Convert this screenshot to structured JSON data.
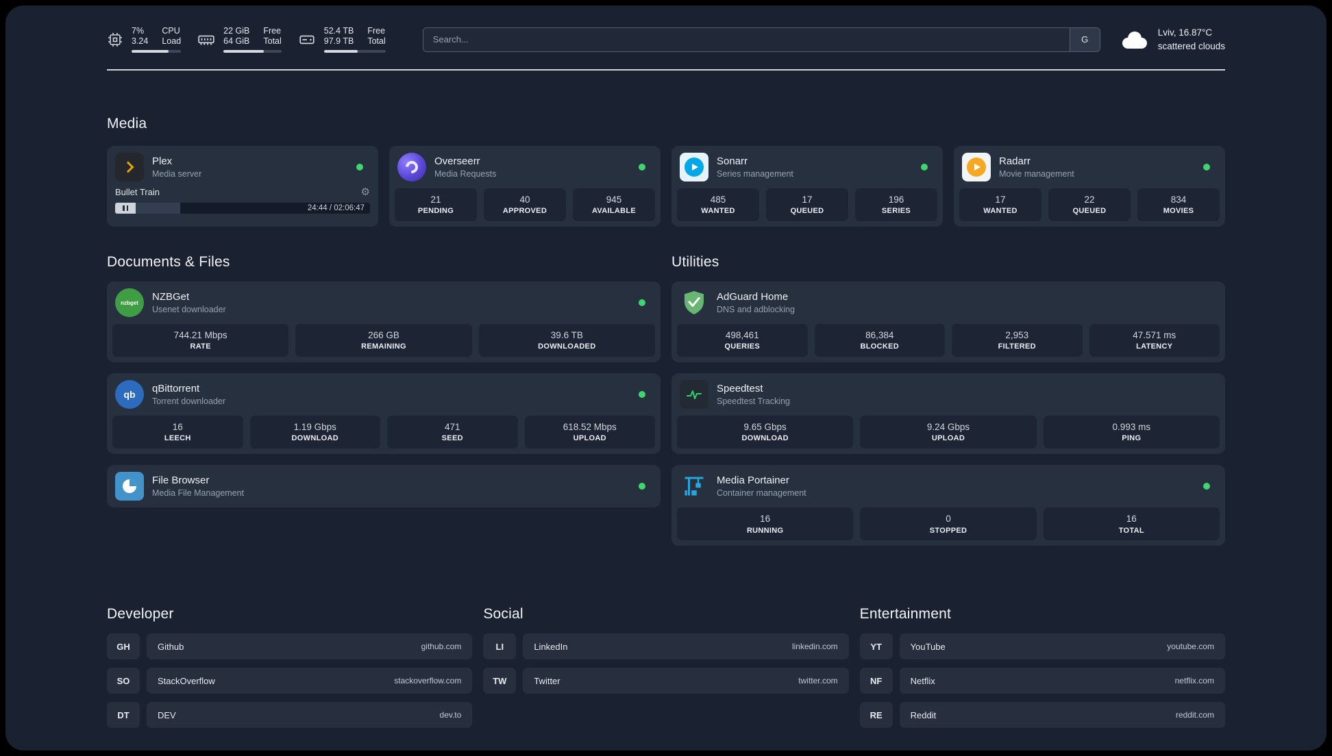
{
  "topbar": {
    "cpu": {
      "value1": "7%",
      "label1": "CPU",
      "value2": "3.24",
      "label2": "Load"
    },
    "memory": {
      "value1": "22 GiB",
      "label1": "Free",
      "value2": "64 GiB",
      "label2": "Total"
    },
    "disk": {
      "value1": "52.4 TB",
      "label1": "Free",
      "value2": "97.9 TB",
      "label2": "Total"
    },
    "search": {
      "placeholder": "Search...",
      "provider_label": "G"
    },
    "weather": {
      "location": "Lviv, 16.87°C",
      "condition": "scattered clouds"
    }
  },
  "sections": {
    "media": {
      "title": "Media"
    },
    "documents": {
      "title": "Documents & Files"
    },
    "utilities": {
      "title": "Utilities"
    },
    "developer": {
      "title": "Developer"
    },
    "social": {
      "title": "Social"
    },
    "entertainment": {
      "title": "Entertainment"
    }
  },
  "apps": {
    "plex": {
      "name": "Plex",
      "subtitle": "Media server",
      "status": "online",
      "player": {
        "title": "Bullet Train",
        "time": "24:44 / 02:06:47"
      }
    },
    "overseerr": {
      "name": "Overseerr",
      "subtitle": "Media Requests",
      "status": "online",
      "stats": [
        {
          "value": "21",
          "label": "PENDING"
        },
        {
          "value": "40",
          "label": "APPROVED"
        },
        {
          "value": "945",
          "label": "AVAILABLE"
        }
      ]
    },
    "sonarr": {
      "name": "Sonarr",
      "subtitle": "Series management",
      "status": "online",
      "stats": [
        {
          "value": "485",
          "label": "WANTED"
        },
        {
          "value": "17",
          "label": "QUEUED"
        },
        {
          "value": "196",
          "label": "SERIES"
        }
      ]
    },
    "radarr": {
      "name": "Radarr",
      "subtitle": "Movie management",
      "status": "online",
      "stats": [
        {
          "value": "17",
          "label": "WANTED"
        },
        {
          "value": "22",
          "label": "QUEUED"
        },
        {
          "value": "834",
          "label": "MOVIES"
        }
      ]
    },
    "nzbget": {
      "name": "NZBGet",
      "subtitle": "Usenet downloader",
      "status": "online",
      "icon_text": "nzbget",
      "stats": [
        {
          "value": "744.21 Mbps",
          "label": "RATE"
        },
        {
          "value": "266 GB",
          "label": "REMAINING"
        },
        {
          "value": "39.6 TB",
          "label": "DOWNLOADED"
        }
      ]
    },
    "qbittorrent": {
      "name": "qBittorrent",
      "subtitle": "Torrent downloader",
      "status": "online",
      "icon_text": "qb",
      "stats": [
        {
          "value": "16",
          "label": "LEECH"
        },
        {
          "value": "1.19 Gbps",
          "label": "DOWNLOAD"
        },
        {
          "value": "471",
          "label": "SEED"
        },
        {
          "value": "618.52 Mbps",
          "label": "UPLOAD"
        }
      ]
    },
    "filebrowser": {
      "name": "File Browser",
      "subtitle": "Media File Management",
      "status": "online"
    },
    "adguard": {
      "name": "AdGuard Home",
      "subtitle": "DNS and adblocking",
      "stats": [
        {
          "value": "498,461",
          "label": "QUERIES"
        },
        {
          "value": "86,384",
          "label": "BLOCKED"
        },
        {
          "value": "2,953",
          "label": "FILTERED"
        },
        {
          "value": "47.571 ms",
          "label": "LATENCY"
        }
      ]
    },
    "speedtest": {
      "name": "Speedtest",
      "subtitle": "Speedtest Tracking",
      "stats": [
        {
          "value": "9.65 Gbps",
          "label": "DOWNLOAD"
        },
        {
          "value": "9.24 Gbps",
          "label": "UPLOAD"
        },
        {
          "value": "0.993 ms",
          "label": "PING"
        }
      ]
    },
    "portainer": {
      "name": "Media Portainer",
      "subtitle": "Container management",
      "status": "online",
      "stats": [
        {
          "value": "16",
          "label": "RUNNING"
        },
        {
          "value": "0",
          "label": "STOPPED"
        },
        {
          "value": "16",
          "label": "TOTAL"
        }
      ]
    }
  },
  "bookmarks": {
    "developer": [
      {
        "abbr": "GH",
        "name": "Github",
        "url": "github.com"
      },
      {
        "abbr": "SO",
        "name": "StackOverflow",
        "url": "stackoverflow.com"
      },
      {
        "abbr": "DT",
        "name": "DEV",
        "url": "dev.to"
      }
    ],
    "social": [
      {
        "abbr": "LI",
        "name": "LinkedIn",
        "url": "linkedin.com"
      },
      {
        "abbr": "TW",
        "name": "Twitter",
        "url": "twitter.com"
      }
    ],
    "entertainment": [
      {
        "abbr": "YT",
        "name": "YouTube",
        "url": "youtube.com"
      },
      {
        "abbr": "NF",
        "name": "Netflix",
        "url": "netflix.com"
      },
      {
        "abbr": "RE",
        "name": "Reddit",
        "url": "reddit.com"
      }
    ]
  },
  "colors": {
    "status_online": "#3fd56f",
    "plex_accent": "#e5a00d",
    "overseerr_accent": "#5a48d6",
    "sonarr_accent": "#00a8e8",
    "radarr_accent": "#f7a823",
    "nzbget_accent": "#3f9e44",
    "qbittorrent_accent": "#2d6bbf",
    "filebrowser_accent": "#4193c9",
    "adguard_accent": "#67b671",
    "speedtest_accent": "#2dd36f",
    "portainer_accent": "#27a5dd"
  }
}
